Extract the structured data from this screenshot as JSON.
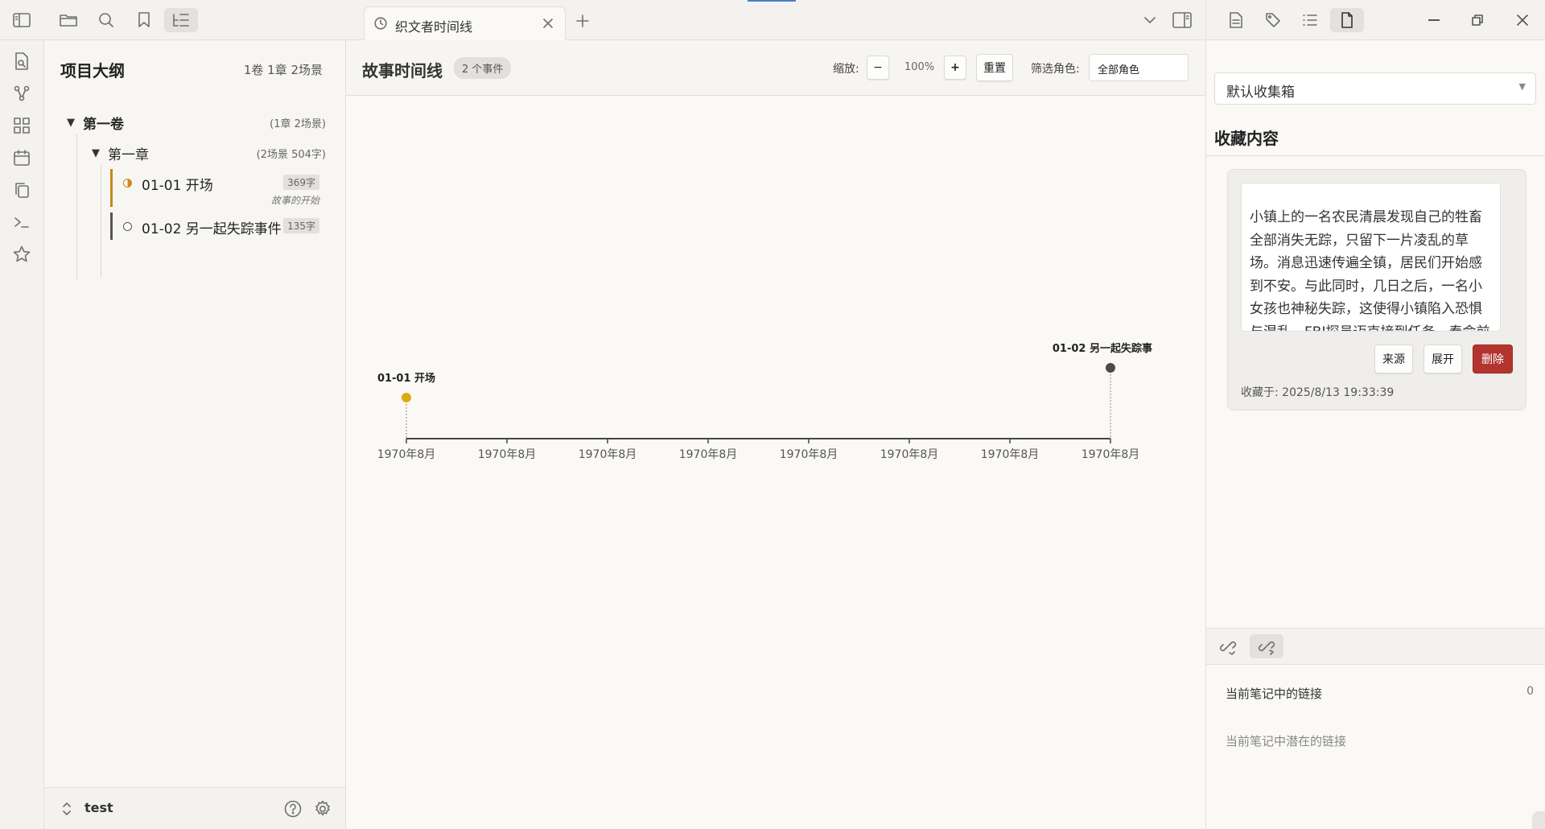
{
  "sidebar": {
    "title": "项目大纲",
    "summary": "1卷 1章 2场景",
    "volume": {
      "label": "第一卷",
      "meta": "(1章 2场景)"
    },
    "chapter": {
      "label": "第一章",
      "meta": "(2场景 504字)"
    },
    "scenes": [
      {
        "label": "01-01 开场",
        "words": "369字",
        "subtitle": "故事的开始",
        "status_color": "#d08a1c"
      },
      {
        "label": "01-02 另一起失踪事件",
        "words": "135字",
        "subtitle": "",
        "status_color": "#555555"
      }
    ],
    "footer": {
      "vault_name": "test"
    }
  },
  "tab": {
    "label": "织文者时间线"
  },
  "timeline": {
    "title": "故事时间线",
    "count_badge": "2 个事件",
    "zoom_label": "缩放:",
    "zoom_value": "100%",
    "zoom_minus": "−",
    "zoom_plus": "+",
    "reset_label": "重置",
    "filter_label": "筛选角色:",
    "filter_value": "全部角色"
  },
  "chart_data": {
    "type": "scatter",
    "x_tick_labels": [
      "1970年8月",
      "1970年8月",
      "1970年8月",
      "1970年8月",
      "1970年8月",
      "1970年8月",
      "1970年8月",
      "1970年8月"
    ],
    "events": [
      {
        "label": "01-01 开场",
        "tick_index": 0,
        "color": "#e0a910"
      },
      {
        "label": "01-02 另一起失踪事",
        "tick_index": 7,
        "color": "#4a4a4a"
      }
    ]
  },
  "right_panel": {
    "inbox_select": "默认收集箱",
    "fav_title": "收藏内容",
    "card": {
      "text": "小镇上的一名农民清晨发现自己的牲畜全部消失无踪，只留下一片凌乱的草场。消息迅速传遍全镇，居民们开始感到不安。与此同时，几日之后，一名小女孩也神秘失踪，这使得小镇陷入恐惧与混乱。FBI探员迈克接到任务，奉命前",
      "source_btn": "来源",
      "expand_btn": "展开",
      "delete_btn": "删除",
      "saved_at": "收藏于: 2025/8/13 19:33:39"
    },
    "links": {
      "current_label": "当前笔记中的链接",
      "current_count": "0",
      "potential_label": "当前笔记中潜在的链接"
    }
  },
  "colors": {
    "accent": "#c8861a",
    "danger": "#b3342f",
    "topline": "#4a7fc1"
  }
}
